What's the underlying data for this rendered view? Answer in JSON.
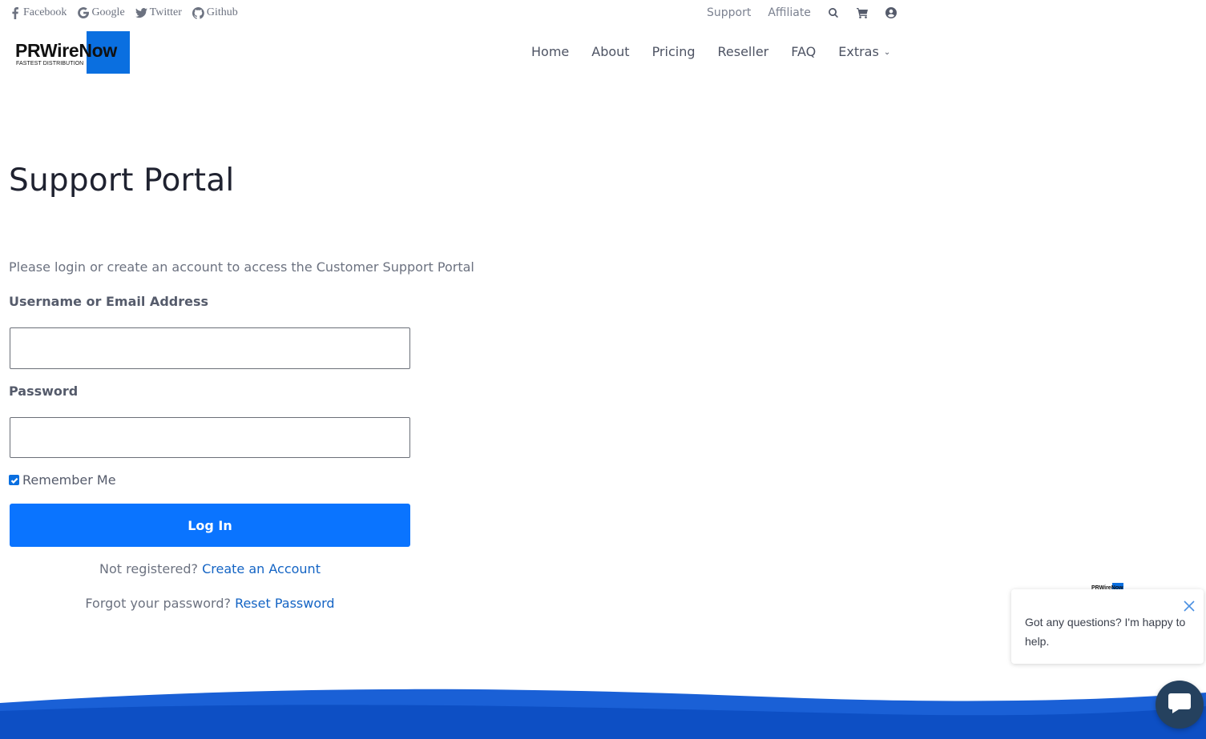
{
  "topbar": {
    "social": [
      {
        "label": "Facebook",
        "icon": "facebook-icon"
      },
      {
        "label": "Google",
        "icon": "google-icon"
      },
      {
        "label": "Twitter",
        "icon": "twitter-icon"
      },
      {
        "label": "Github",
        "icon": "github-icon"
      }
    ],
    "links": {
      "support": "Support",
      "affiliate": "Affiliate"
    },
    "icons": [
      "search-icon",
      "cart-icon",
      "user-circle-icon"
    ]
  },
  "logo": {
    "word": "PRWireNow",
    "tagline": "FASTEST DISTRIBUTION"
  },
  "nav": {
    "home": "Home",
    "about": "About",
    "pricing": "Pricing",
    "reseller": "Reseller",
    "faq": "FAQ",
    "extras": "Extras"
  },
  "page": {
    "title": "Support Portal",
    "intro": "Please login or create an account to access the Customer Support Portal"
  },
  "form": {
    "username_label": "Username or Email Address",
    "username_value": "",
    "password_label": "Password",
    "password_value": "",
    "remember_label": "Remember Me",
    "remember_checked": true,
    "login_label": "Log In",
    "not_registered": "Not registered?",
    "create_account": "Create an Account",
    "forgot_password": "Forgot your password?",
    "reset_password": "Reset Password"
  },
  "chat": {
    "logo": "PRWireNow",
    "message": "Got any questions? I'm happy to help."
  },
  "colors": {
    "accent": "#0a74ff",
    "link": "#1464c4",
    "footer": "#0d4fc4",
    "chat_bubble": "#25415e"
  }
}
